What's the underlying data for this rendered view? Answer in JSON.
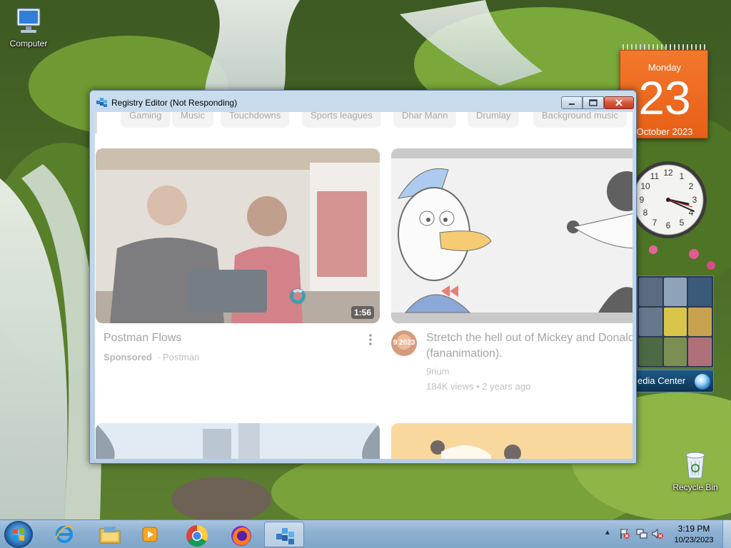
{
  "desktop": {
    "icons": [
      {
        "label": "Computer",
        "icon": "computer-icon"
      },
      {
        "label": "Recycle Bin",
        "icon": "recycle-bin-icon"
      }
    ]
  },
  "gadgets": {
    "calendar": {
      "weekday": "Monday",
      "day": "23",
      "month_year": "October 2023"
    },
    "clock": {
      "time": "3:19",
      "numerals": [
        "12",
        "1",
        "2",
        "3",
        "4",
        "5",
        "6",
        "7",
        "8",
        "9",
        "10",
        "11"
      ]
    },
    "media_center": {
      "label": "edia Center"
    }
  },
  "window": {
    "title": "Registry Editor (Not Responding)",
    "title_icon": "registry-editor-icon",
    "controls": {
      "minimize": "minimize-icon",
      "maximize": "maximize-icon",
      "close": "close-icon"
    },
    "chips": [
      "Gaming",
      "Music",
      "Touchdowns",
      "Sports leagues",
      "Dhar Mann",
      "Drumlay",
      "Background music"
    ],
    "videos": [
      {
        "title": "Postman Flows",
        "sponsored": "Sponsored",
        "channel": "· Postman",
        "duration": "1:56"
      },
      {
        "title": "Stretch the hell out of Mickey and Donald (fananimation).",
        "channel": "9rium",
        "stats": "184K views • 2 years ago",
        "avatar_text": "9 2023"
      }
    ]
  },
  "taskbar": {
    "pinned": [
      {
        "name": "internet-explorer",
        "icon": "internet-explorer-icon"
      },
      {
        "name": "windows-explorer",
        "icon": "folder-icon"
      },
      {
        "name": "windows-media-player",
        "icon": "media-player-icon"
      },
      {
        "name": "google-chrome",
        "icon": "chrome-icon"
      },
      {
        "name": "firefox",
        "icon": "firefox-icon"
      },
      {
        "name": "registry-editor",
        "icon": "registry-editor-icon",
        "active": true
      }
    ],
    "tray": {
      "time": "3:19 PM",
      "date": "10/23/2023",
      "icons": [
        "action-center-flag-icon",
        "network-icon",
        "volume-muted-icon"
      ]
    }
  },
  "colors": {
    "taskbar": "#8cb0d2",
    "calendar": "#e85f17",
    "close_button": "#c43d21"
  }
}
